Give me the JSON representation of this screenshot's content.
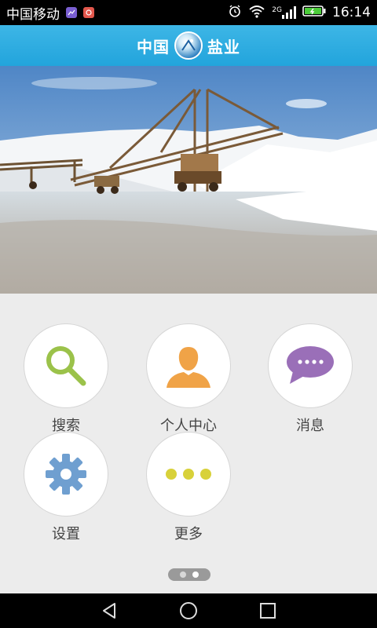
{
  "status_bar": {
    "carrier": "中国移动",
    "time": "16:14",
    "network": "2G",
    "icons": [
      "image-notification-icon",
      "app-notification-icon",
      "alarm-icon",
      "wifi-icon",
      "signal-icon",
      "battery-charging-icon"
    ]
  },
  "header": {
    "brand_left": "中国",
    "brand_right": "盐业",
    "logo_icon": "salt-logo-icon"
  },
  "banner": {
    "description_icon": "salt-field-photo"
  },
  "menu": {
    "items": [
      {
        "label": "搜索",
        "icon": "search-icon",
        "color": "#9bc24a"
      },
      {
        "label": "个人中心",
        "icon": "person-icon",
        "color": "#f0a347"
      },
      {
        "label": "消息",
        "icon": "message-icon",
        "color": "#9a6fb8"
      },
      {
        "label": "设置",
        "icon": "gear-icon",
        "color": "#6f9fd0"
      },
      {
        "label": "更多",
        "icon": "more-icon",
        "color": "#d8d13a"
      }
    ]
  },
  "pager": {
    "pages": 2,
    "current": 2
  },
  "navbar": {
    "icons": [
      "back-icon",
      "home-icon",
      "recents-icon"
    ]
  }
}
